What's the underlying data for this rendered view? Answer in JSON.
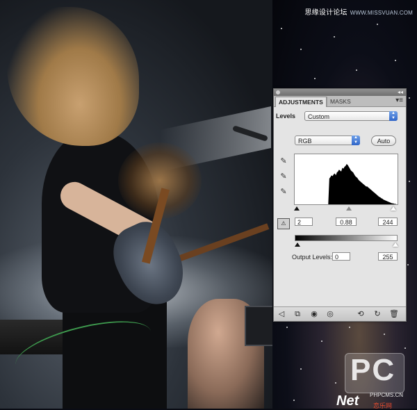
{
  "site_header": {
    "title": "思缘设计论坛",
    "url": "WWW.MISSVUAN.COM"
  },
  "panel": {
    "tabs": [
      {
        "label": "ADJUSTMENTS",
        "active": true
      },
      {
        "label": "MASKS",
        "active": false
      }
    ],
    "adjustment_label": "Levels",
    "preset": {
      "value": "Custom"
    },
    "channel": {
      "value": "RGB"
    },
    "auto_button": "Auto",
    "input_levels": {
      "black": "2",
      "gamma": "0.88",
      "white": "244"
    },
    "output_levels": {
      "label": "Output Levels:",
      "black": "0",
      "white": "255"
    },
    "icons": {
      "eyedroppers": [
        "black-point-eyedropper-icon",
        "gray-point-eyedropper-icon",
        "white-point-eyedropper-icon"
      ],
      "bottom": [
        "back-arrow-icon",
        "clip-to-layer-icon",
        "new-layer-icon",
        "visibility-eye-icon",
        "previous-state-icon",
        "reset-icon",
        "delete-icon"
      ]
    },
    "histogram": [
      0,
      0,
      0,
      0,
      0,
      0,
      0,
      0,
      0,
      0,
      0,
      0,
      0,
      0,
      0,
      0,
      0,
      0,
      0,
      0,
      0,
      0,
      0,
      0,
      0,
      0,
      0,
      0,
      0,
      0,
      0,
      0,
      55,
      58,
      62,
      60,
      64,
      66,
      62,
      68,
      70,
      74,
      72,
      70,
      78,
      76,
      80,
      82,
      86,
      84,
      80,
      76,
      72,
      70,
      68,
      64,
      60,
      58,
      56,
      52,
      50,
      48,
      46,
      44,
      42,
      40,
      38,
      38,
      36,
      34,
      32,
      30,
      28,
      26,
      24,
      22,
      20,
      18,
      16,
      15,
      13,
      12,
      10,
      9,
      8,
      7,
      6,
      5,
      4,
      3,
      2,
      2,
      1,
      1,
      0,
      0
    ]
  },
  "watermark": {
    "logo_text": "PC",
    "domain": "PHPCMS.CN",
    "brand": "Net",
    "brand_cn": "恋乐网"
  },
  "colors": {
    "panel_bg": "#e4e4e4",
    "select_accent": "#2f65c8"
  }
}
